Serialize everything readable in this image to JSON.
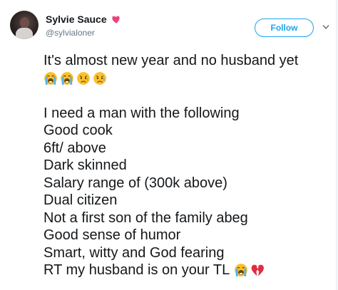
{
  "author": {
    "display_name": "Sylvie Sauce",
    "handle": "@sylvialoner",
    "name_emoji": "sparkling-heart-icon"
  },
  "actions": {
    "follow_label": "Follow",
    "more_icon": "chevron-down-icon"
  },
  "tweet": {
    "line_1": "It's almost new year and no husband yet",
    "line_1_emojis": [
      "loudly-crying-face",
      "loudly-crying-face",
      "disappointed-relieved-face",
      "disappointed-relieved-face"
    ],
    "line_2": "I need a man with the following",
    "line_3": "Good cook",
    "line_4": "6ft/ above",
    "line_5": "Dark skinned",
    "line_6": "Salary range of (300k above)",
    "line_7": "Dual citizen",
    "line_8": "Not a first son of the family abeg",
    "line_9": "Good sense of humor",
    "line_10": "Smart, witty and God fearing",
    "line_11": "RT my husband is on your TL",
    "line_11_emojis": [
      "loudly-crying-face",
      "broken-heart"
    ]
  },
  "colors": {
    "link_blue": "#1da1f2",
    "text_primary": "#14171a",
    "text_secondary": "#657786",
    "heart_pink": "#e8457a",
    "emoji_yellow": "#fbc02d",
    "tear_blue": "#4fb3ec",
    "broken_heart_red": "#dd2e44"
  }
}
